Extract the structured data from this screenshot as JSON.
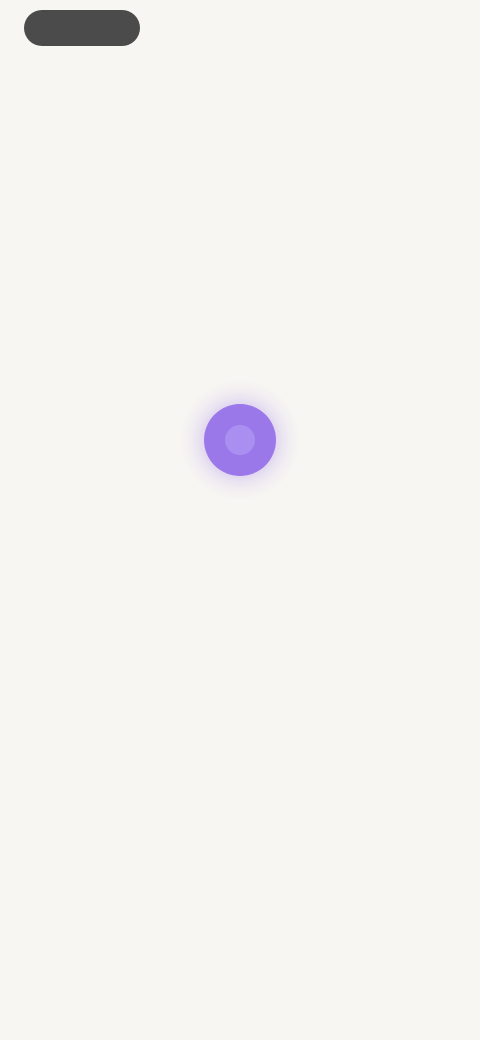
{
  "top_button": {
    "label": ""
  },
  "status": {
    "icon": "assistant-orb-icon",
    "message_line1": "",
    "message_line2": ""
  },
  "colors": {
    "background": "#f7f6f2",
    "pill": "#4b4b4b",
    "accent": "#9a78ea",
    "message_text": "#5d6b5d"
  }
}
